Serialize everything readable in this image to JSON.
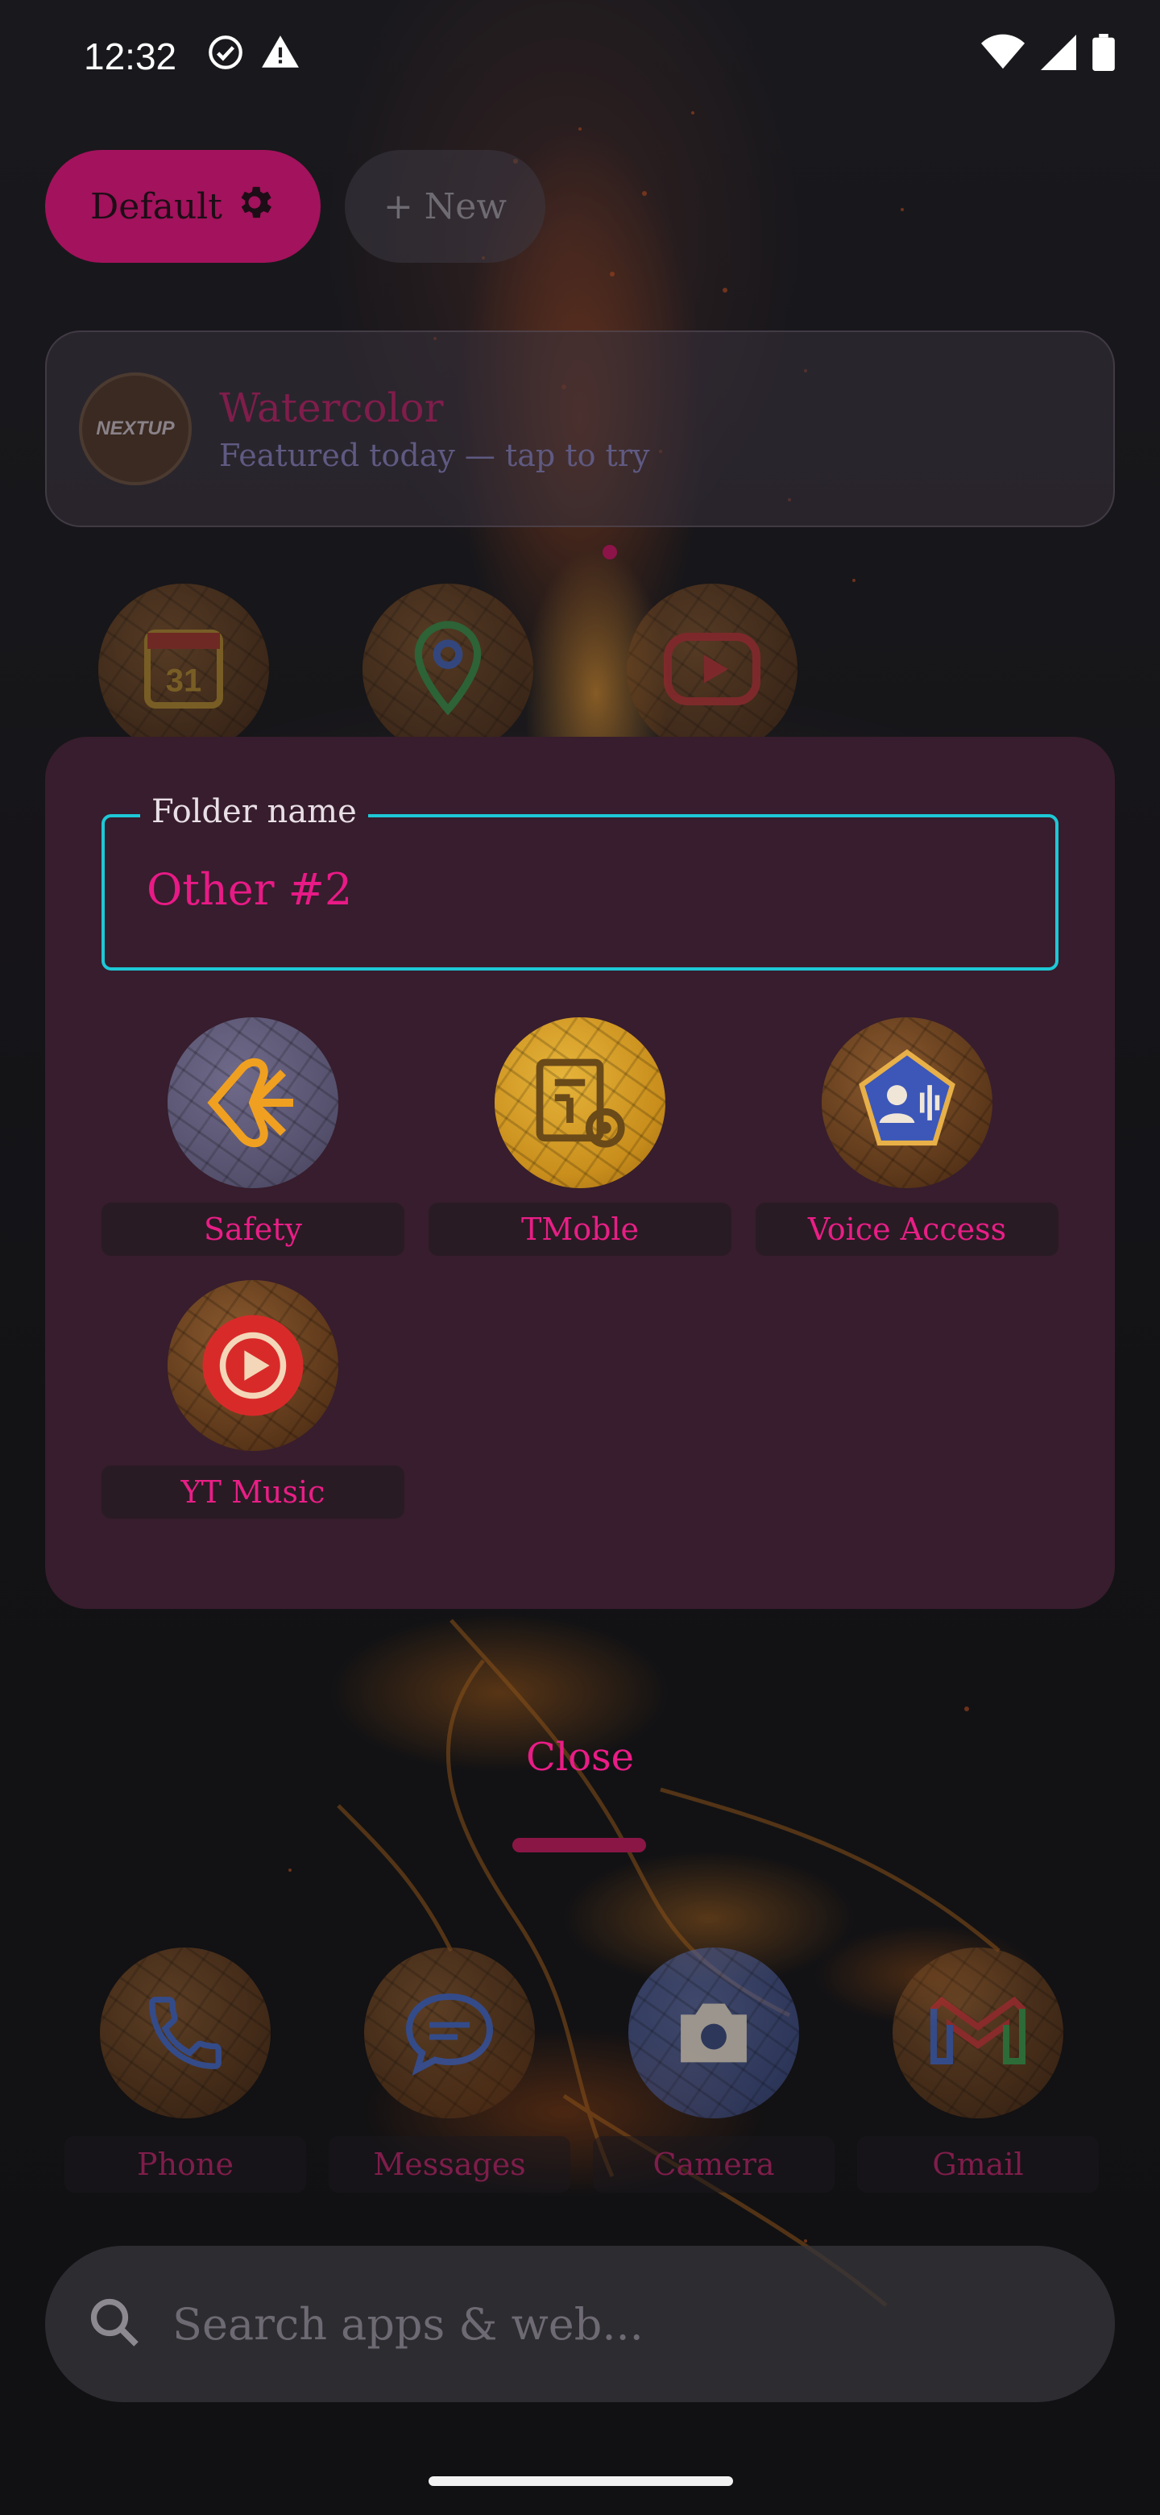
{
  "status_bar": {
    "time": "12:32",
    "left_icons": [
      "check-circle-icon",
      "warning-icon"
    ],
    "right_icons": [
      "wifi-icon",
      "signal-icon",
      "battery-icon"
    ]
  },
  "profiles": {
    "active_label": "Default",
    "active_icon": "gear-icon",
    "new_label": "+ New"
  },
  "banner": {
    "logo_text": "NEXTUP",
    "title": "Watercolor",
    "subtitle": "Featured today — tap to try"
  },
  "background_apps": [
    {
      "name": "Calendar",
      "icon": "calendar-icon",
      "badge": "31"
    },
    {
      "name": "Maps",
      "icon": "map-pin-icon"
    },
    {
      "name": "YouTube",
      "icon": "youtube-icon"
    }
  ],
  "folder": {
    "field_label": "Folder name",
    "name": "Other #2",
    "apps": [
      {
        "label": "Safety",
        "icon": "safety-icon"
      },
      {
        "label": "TMoble",
        "icon": "tmobile-settings-icon"
      },
      {
        "label": "Voice Access",
        "icon": "voice-access-icon"
      },
      {
        "label": "YT Music",
        "icon": "yt-music-icon"
      }
    ]
  },
  "close_label": "Close",
  "dock": [
    {
      "label": "Phone",
      "icon": "phone-icon"
    },
    {
      "label": "Messages",
      "icon": "messages-icon"
    },
    {
      "label": "Camera",
      "icon": "camera-icon"
    },
    {
      "label": "Gmail",
      "icon": "gmail-icon"
    }
  ],
  "search": {
    "placeholder": "Search apps & web..."
  },
  "colors": {
    "accent": "#e91e86",
    "chip_active": "#a3125c",
    "folder_bg": "#371d2d",
    "field_outline": "#1ec8d6"
  }
}
